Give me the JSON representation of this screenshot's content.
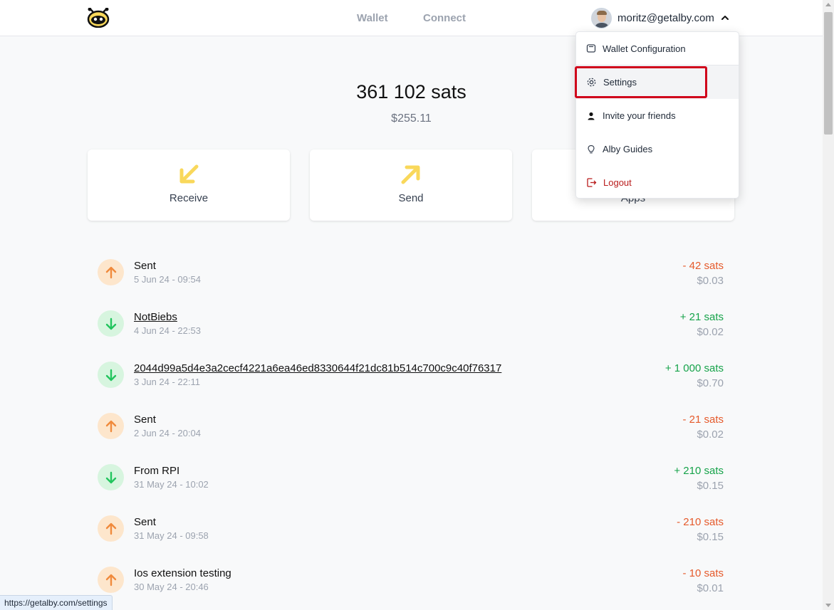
{
  "nav": {
    "wallet": "Wallet",
    "connect": "Connect"
  },
  "account": {
    "email": "moritz@getalby.com"
  },
  "balance": {
    "sats": "361 102 sats",
    "fiat": "$255.11"
  },
  "actions": {
    "receive": "Receive",
    "send": "Send",
    "apps": "Apps"
  },
  "menu": {
    "wallet_configuration": "Wallet Configuration",
    "settings": "Settings",
    "invite": "Invite your friends",
    "guides": "Alby Guides",
    "logout": "Logout"
  },
  "transactions": [
    {
      "title": "Sent",
      "date": "5 Jun 24 - 09:54",
      "amount": "- 42 sats",
      "fiat": "$0.03",
      "direction": "out"
    },
    {
      "title": "NotBiebs",
      "date": "4 Jun 24 - 22:53",
      "amount": "+ 21 sats",
      "fiat": "$0.02",
      "direction": "in"
    },
    {
      "title": "2044d99a5d4e3a2cecf4221a6ea46ed8330644f21dc81b514c700c9c40f76317",
      "date": "3 Jun 24 - 22:11",
      "amount": "+ 1 000 sats",
      "fiat": "$0.70",
      "direction": "in"
    },
    {
      "title": "Sent",
      "date": "2 Jun 24 - 20:04",
      "amount": "- 21 sats",
      "fiat": "$0.02",
      "direction": "out"
    },
    {
      "title": "From RPI",
      "date": "31 May 24 - 10:02",
      "amount": "+ 210 sats",
      "fiat": "$0.15",
      "direction": "in"
    },
    {
      "title": "Sent",
      "date": "31 May 24 - 09:58",
      "amount": "- 210 sats",
      "fiat": "$0.15",
      "direction": "out"
    },
    {
      "title": "Ios extension testing",
      "date": "30 May 24 - 20:46",
      "amount": "- 10 sats",
      "fiat": "$0.01",
      "direction": "out"
    }
  ],
  "status_bar": {
    "url": "https://getalby.com/settings"
  },
  "colors": {
    "accent": "#f9d85b",
    "outgoing": "#e55a2b",
    "incoming": "#16a34a",
    "highlight": "#d0021b"
  }
}
